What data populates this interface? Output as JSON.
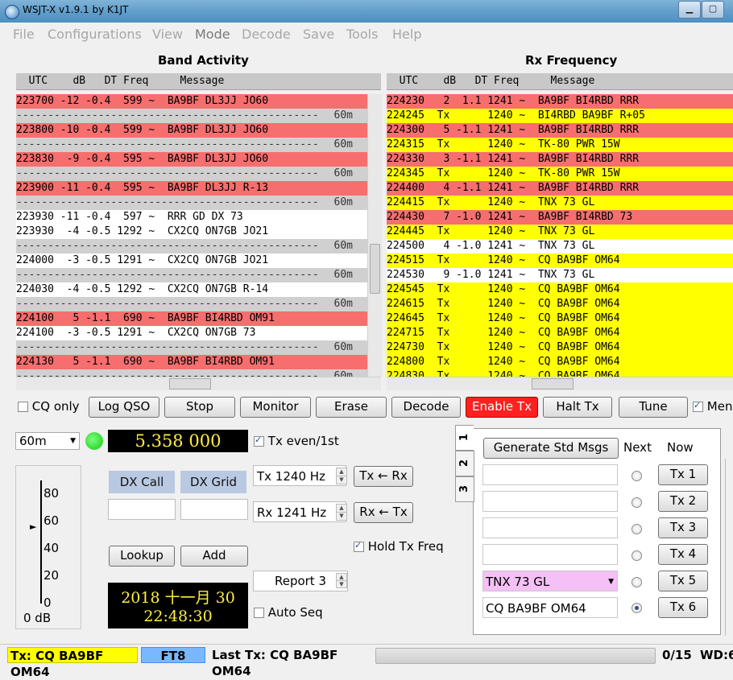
{
  "window": {
    "title": "WSJT-X   v1.9.1   by K1JT"
  },
  "menu": [
    "File",
    "Configurations",
    "View",
    "Mode",
    "Decode",
    "Save",
    "Tools",
    "Help"
  ],
  "band_activity": {
    "title": "Band Activity",
    "header": "  UTC    dB   DT Freq     Message",
    "rows": [
      {
        "t": "223700 -12 -0.4  599 ~  BA9BF DL3JJ JO60",
        "c": "#f66e6e"
      },
      {
        "t": "",
        "band": "60m",
        "dash": true
      },
      {
        "t": "223800 -10 -0.4  599 ~  BA9BF DL3JJ JO60",
        "c": "#f66e6e"
      },
      {
        "t": "",
        "band": "60m",
        "dash": true
      },
      {
        "t": "223830  -9 -0.4  595 ~  BA9BF DL3JJ JO60",
        "c": "#f66e6e"
      },
      {
        "t": "",
        "band": "60m",
        "dash": true
      },
      {
        "t": "223900 -11 -0.4  595 ~  BA9BF DL3JJ R-13",
        "c": "#f66e6e"
      },
      {
        "t": "",
        "band": "60m",
        "dash": true
      },
      {
        "t": "223930 -11 -0.4  597 ~  RRR GD DX 73",
        "c": "#ffffff"
      },
      {
        "t": "223930  -4 -0.5 1292 ~  CX2CQ ON7GB JO21",
        "c": "#ffffff"
      },
      {
        "t": "",
        "band": "60m",
        "dash": true
      },
      {
        "t": "224000  -3 -0.5 1291 ~  CX2CQ ON7GB JO21",
        "c": "#ffffff"
      },
      {
        "t": "",
        "band": "60m",
        "dash": true
      },
      {
        "t": "224030  -4 -0.5 1292 ~  CX2CQ ON7GB R-14",
        "c": "#ffffff"
      },
      {
        "t": "",
        "band": "60m",
        "dash": true
      },
      {
        "t": "224100   5 -1.1  690 ~  BA9BF BI4RBD OM91",
        "c": "#f66e6e"
      },
      {
        "t": "224100  -3 -0.5 1291 ~  CX2CQ ON7GB 73",
        "c": "#ffffff"
      },
      {
        "t": "",
        "band": "60m",
        "dash": true
      },
      {
        "t": "224130   5 -1.1  690 ~  BA9BF BI4RBD OM91",
        "c": "#f66e6e"
      },
      {
        "t": "",
        "band": "60m",
        "dash": true
      }
    ]
  },
  "rx_frequency": {
    "title": "Rx Frequency",
    "header": "  UTC    dB   DT Freq     Message",
    "rows": [
      {
        "t": "224230   2  1.1 1241 ~  BA9BF BI4RBD RRR",
        "c": "#f66e6e"
      },
      {
        "t": "224245  Tx      1240 ~  BI4RBD BA9BF R+05",
        "c": "#ffff00"
      },
      {
        "t": "224300   5 -1.1 1241 ~  BA9BF BI4RBD RRR",
        "c": "#f66e6e"
      },
      {
        "t": "224315  Tx      1240 ~  TK-80 PWR 15W",
        "c": "#ffff00"
      },
      {
        "t": "224330   3 -1.1 1241 ~  BA9BF BI4RBD RRR",
        "c": "#f66e6e"
      },
      {
        "t": "224345  Tx      1240 ~  TK-80 PWR 15W",
        "c": "#ffff00"
      },
      {
        "t": "224400   4 -1.1 1241 ~  BA9BF BI4RBD RRR",
        "c": "#f66e6e"
      },
      {
        "t": "224415  Tx      1240 ~  TNX 73 GL",
        "c": "#ffff00"
      },
      {
        "t": "224430   7 -1.0 1241 ~  BA9BF BI4RBD 73",
        "c": "#f66e6e"
      },
      {
        "t": "224445  Tx      1240 ~  TNX 73 GL",
        "c": "#ffff00"
      },
      {
        "t": "224500   4 -1.0 1241 ~  TNX 73 GL",
        "c": "#ffffff"
      },
      {
        "t": "224515  Tx      1240 ~  CQ BA9BF OM64",
        "c": "#ffff00"
      },
      {
        "t": "224530   9 -1.0 1241 ~  TNX 73 GL",
        "c": "#ffffff"
      },
      {
        "t": "224545  Tx      1240 ~  CQ BA9BF OM64",
        "c": "#ffff00"
      },
      {
        "t": "224615  Tx      1240 ~  CQ BA9BF OM64",
        "c": "#ffff00"
      },
      {
        "t": "224645  Tx      1240 ~  CQ BA9BF OM64",
        "c": "#ffff00"
      },
      {
        "t": "224715  Tx      1240 ~  CQ BA9BF OM64",
        "c": "#ffff00"
      },
      {
        "t": "224730  Tx      1240 ~  CQ BA9BF OM64",
        "c": "#ffff00"
      },
      {
        "t": "224800  Tx      1240 ~  CQ BA9BF OM64",
        "c": "#ffff00"
      },
      {
        "t": "224830  Tx      1240 ~  CQ BA9BF OM64",
        "c": "#ffff00"
      }
    ]
  },
  "buttons": {
    "cq_only": "CQ only",
    "log_qso": "Log QSO",
    "stop": "Stop",
    "monitor": "Monitor",
    "erase": "Erase",
    "decode": "Decode",
    "enable_tx": "Enable Tx",
    "halt_tx": "Halt Tx",
    "tune": "Tune",
    "menus": "Menus"
  },
  "controls": {
    "band": "60m",
    "frequency": "5.358  000",
    "tx_even": "Tx even/1st",
    "tx_freq": "Tx  1240  Hz",
    "rx_freq": "Rx  1241  Hz",
    "tx_from_rx": "Tx ← Rx",
    "rx_from_tx": "Rx ← Tx",
    "hold_tx_freq": "Hold Tx Freq",
    "report": "Report 3",
    "auto_seq": "Auto Seq",
    "dx_call_label": "DX Call",
    "dx_grid_label": "DX Grid",
    "dx_call_value": "",
    "dx_grid_value": "",
    "lookup": "Lookup",
    "add": "Add",
    "date": "2018  十一月  30",
    "time": "22:48:30",
    "meter_labels": [
      "80",
      "60",
      "40",
      "20",
      "0"
    ],
    "meter_unit": "0 dB",
    "meter_level": 62
  },
  "tx_panel": {
    "tabs": [
      "1",
      "2",
      "3"
    ],
    "generate": "Generate Std Msgs",
    "next": "Next",
    "now": "Now",
    "messages": [
      "",
      "",
      "",
      "",
      "TNX 73 GL",
      "CQ BA9BF OM64"
    ],
    "tx_buttons": [
      "Tx 1",
      "Tx 2",
      "Tx 3",
      "Tx 4",
      "Tx 5",
      "Tx 6"
    ],
    "selected": 5
  },
  "status": {
    "tx": "Tx: CQ BA9BF OM64",
    "mode": "FT8",
    "last_tx": "Last Tx: CQ BA9BF OM64",
    "progress": "0/15",
    "wd": "WD:6"
  }
}
